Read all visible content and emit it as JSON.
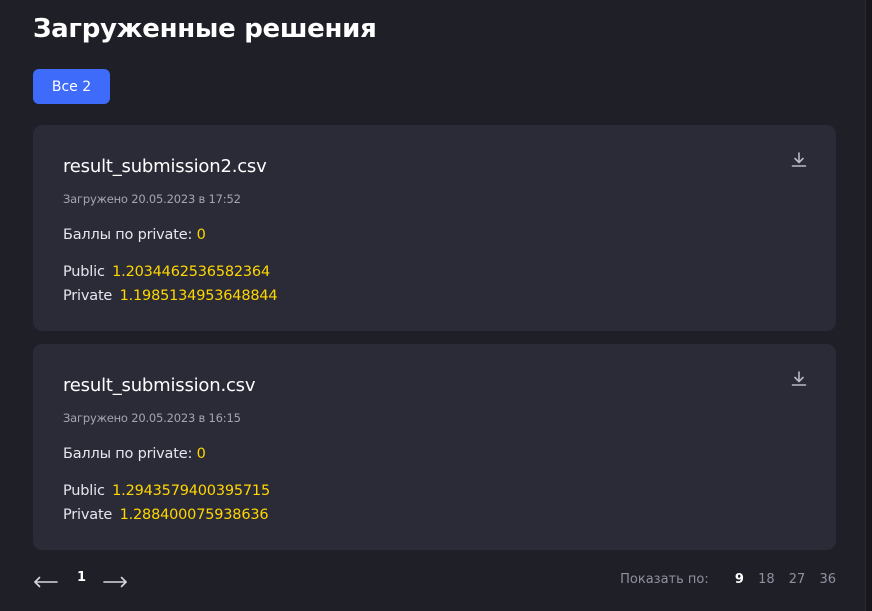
{
  "header": {
    "title": "Загруженные решения"
  },
  "filters": {
    "all_label": "Все 2"
  },
  "submissions": [
    {
      "file_name": "result_submission2.csv",
      "uploaded": "Загружено 20.05.2023 в 17:52",
      "score_label": "Баллы по private:",
      "score_value": "0",
      "public_label": "Public",
      "public_value": "1.2034462536582364",
      "private_label": "Private",
      "private_value": "1.1985134953648844"
    },
    {
      "file_name": "result_submission.csv",
      "uploaded": "Загружено 20.05.2023 в 16:15",
      "score_label": "Баллы по private:",
      "score_value": "0",
      "public_label": "Public",
      "public_value": "1.2943579400395715",
      "private_label": "Private",
      "private_value": "1.288400075938636"
    }
  ],
  "pagination": {
    "current_page": "1",
    "prev_icon": "arrow-left-icon",
    "next_icon": "arrow-right-icon",
    "per_page_label": "Показать по:",
    "per_page_options": [
      "9",
      "18",
      "27",
      "36"
    ],
    "per_page_selected": "9"
  },
  "colors": {
    "background": "#1f1f27",
    "card": "#2a2b37",
    "accent": "#3f6bfb",
    "score_highlight": "#ffd600"
  }
}
